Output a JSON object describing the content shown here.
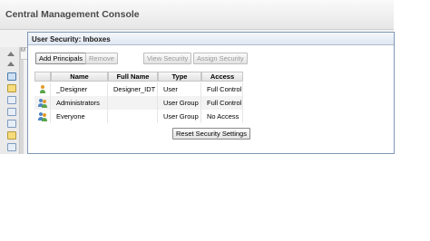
{
  "console": {
    "title": "Central Management Console",
    "tab_stub": "M"
  },
  "dialog": {
    "title": "User Security: Inboxes",
    "buttons": {
      "add_principals": "Add Principals",
      "remove": "Remove",
      "view_security": "View Security",
      "assign_security": "Assign Security",
      "reset": "Reset Security Settings"
    },
    "table": {
      "columns": [
        "Name",
        "Full Name",
        "Type",
        "Access"
      ],
      "rows": [
        {
          "icon": "user-icon",
          "name": "_Designer",
          "full_name": "Designer_IDT",
          "type": "User",
          "access": "Full Control"
        },
        {
          "icon": "user-group-icon",
          "name": "Administrators",
          "full_name": "",
          "type": "User Group",
          "access": "Full Control"
        },
        {
          "icon": "user-group-icon",
          "name": "Everyone",
          "full_name": "",
          "type": "User Group",
          "access": "No Access"
        }
      ]
    }
  }
}
